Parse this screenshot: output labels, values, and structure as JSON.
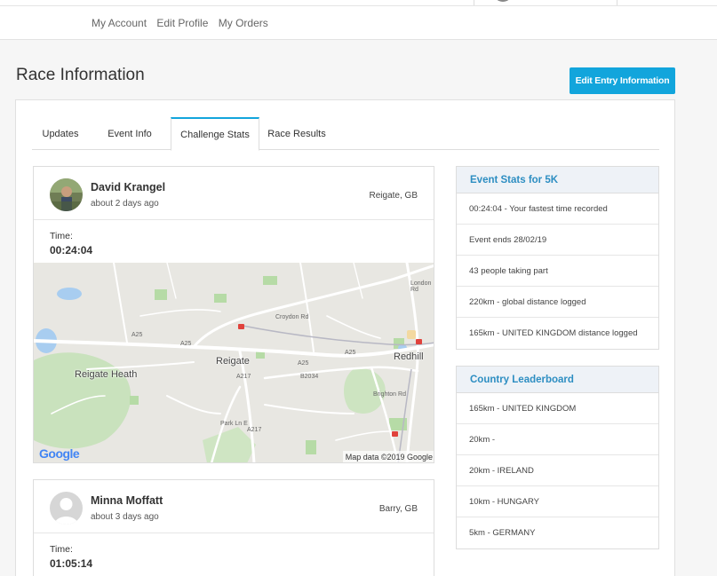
{
  "topnav": {
    "items": [
      "My Account",
      "Edit Profile",
      "My Orders"
    ]
  },
  "page": {
    "title": "Race Information",
    "edit_label": "Edit Entry Information"
  },
  "tabs": [
    {
      "label": "Updates",
      "active": false
    },
    {
      "label": "Event Info",
      "active": false
    },
    {
      "label": "Challenge Stats",
      "active": true
    },
    {
      "label": "Race Results",
      "active": false
    }
  ],
  "posts": [
    {
      "name": "David Krangel",
      "ago": "about 2 days ago",
      "location": "Reigate, GB",
      "time_label": "Time:",
      "time": "00:24:04"
    },
    {
      "name": "Minna Moffatt",
      "ago": "about 3 days ago",
      "location": "Barry, GB",
      "time_label": "Time:",
      "time": "01:05:14"
    }
  ],
  "map": {
    "places": [
      "Reigate",
      "Reigate Heath",
      "Redhill"
    ],
    "roads": [
      "A25",
      "A25",
      "A25",
      "A25",
      "A217",
      "A217",
      "B2034",
      "Croydon Rd",
      "London Rd",
      "Brighton Rd",
      "Park Ln E"
    ],
    "logo": "Google",
    "attribution": "Map data ©2019 Google"
  },
  "event_stats": {
    "title": "Event Stats for 5K",
    "rows": [
      "00:24:04 - Your fastest time recorded",
      "Event ends 28/02/19",
      "43 people taking part",
      "220km - global distance logged",
      "165km - UNITED KINGDOM distance logged"
    ]
  },
  "leaderboard": {
    "title": "Country Leaderboard",
    "rows": [
      "165km - UNITED KINGDOM",
      "20km -",
      "20km - IRELAND",
      "10km - HUNGARY",
      "5km - GERMANY"
    ]
  },
  "colors": {
    "accent": "#12a5dc",
    "box_title": "#2d8ec2",
    "box_header_bg": "#eef2f7"
  }
}
